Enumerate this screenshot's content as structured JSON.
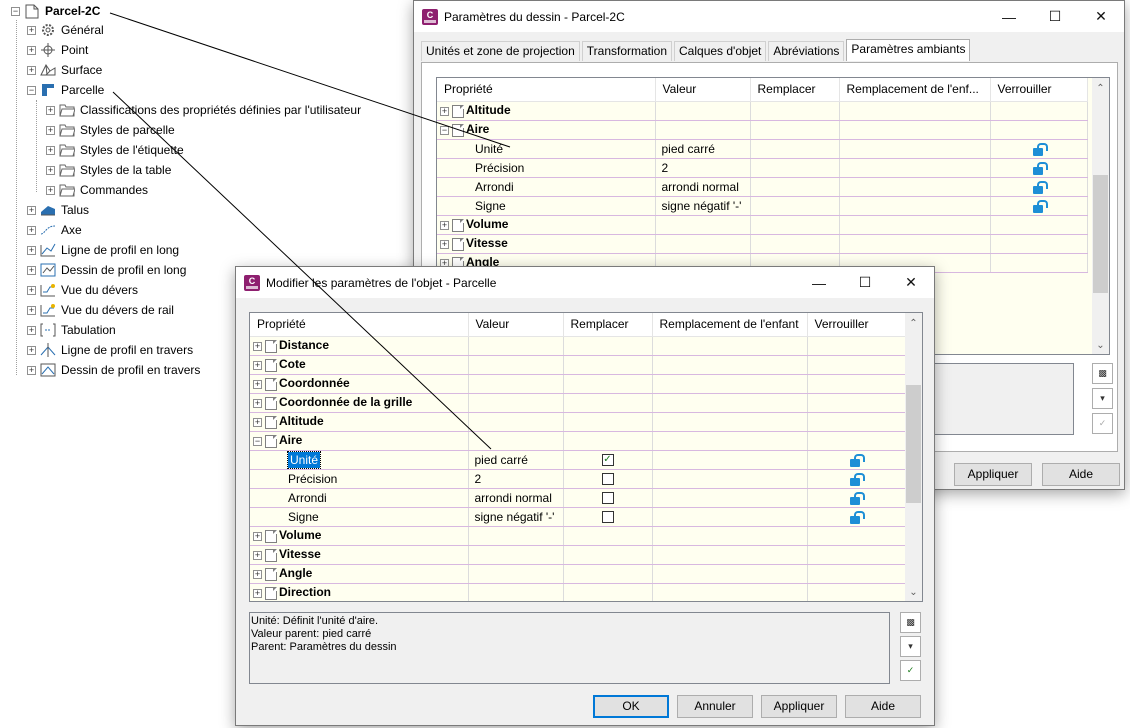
{
  "tree": {
    "root": "Parcel-2C",
    "items": [
      {
        "label": "Général",
        "icon": "gear-icon"
      },
      {
        "label": "Point",
        "icon": "point-icon"
      },
      {
        "label": "Surface",
        "icon": "surface-icon"
      },
      {
        "label": "Parcelle",
        "icon": "parcel-icon"
      },
      {
        "label": "Talus",
        "icon": "grading-icon"
      },
      {
        "label": "Axe",
        "icon": "alignment-icon"
      },
      {
        "label": "Ligne de profil en long",
        "icon": "profile-icon"
      },
      {
        "label": "Dessin de profil en long",
        "icon": "profile-view-icon"
      },
      {
        "label": "Vue du dévers",
        "icon": "superelevation-icon"
      },
      {
        "label": "Vue du dévers de rail",
        "icon": "rail-superelevation-icon"
      },
      {
        "label": "Tabulation",
        "icon": "sample-line-icon"
      },
      {
        "label": "Ligne de profil en travers",
        "icon": "section-icon"
      },
      {
        "label": "Dessin de profil en travers",
        "icon": "section-view-icon"
      }
    ],
    "parcel_children": [
      "Classifications des propriétés définies par l'utilisateur",
      "Styles de parcelle",
      "Styles de l'étiquette",
      "Styles de la table",
      "Commandes"
    ]
  },
  "drawing_settings": {
    "title": "Paramètres du dessin - Parcel-2C",
    "tabs": [
      "Unités et zone de projection",
      "Transformation",
      "Calques d'objet",
      "Abréviations",
      "Paramètres ambiants"
    ],
    "active_tab": "Paramètres ambiants",
    "columns": [
      "Propriété",
      "Valeur",
      "Remplacer",
      "Remplacement de l'enf...",
      "Verrouiller"
    ],
    "rows": [
      {
        "type": "cat",
        "expanded": false,
        "name": "Altitude"
      },
      {
        "type": "cat",
        "expanded": true,
        "name": "Aire"
      },
      {
        "type": "prop",
        "name": "Unité",
        "value": "pied carré"
      },
      {
        "type": "prop",
        "name": "Précision",
        "value": "2"
      },
      {
        "type": "prop",
        "name": "Arrondi",
        "value": "arrondi normal"
      },
      {
        "type": "prop",
        "name": "Signe",
        "value": "signe négatif '-'"
      },
      {
        "type": "cat",
        "expanded": false,
        "name": "Volume"
      },
      {
        "type": "cat",
        "expanded": false,
        "name": "Vitesse"
      },
      {
        "type": "cat",
        "expanded": false,
        "name": "Angle"
      }
    ],
    "buttons": {
      "apply": "Appliquer",
      "help": "Aide"
    }
  },
  "object_settings": {
    "title": "Modifier les paramètres de l'objet - Parcelle",
    "columns": [
      "Propriété",
      "Valeur",
      "Remplacer",
      "Remplacement de l'enfant",
      "Verrouiller"
    ],
    "rows": [
      {
        "type": "cat",
        "name": "Distance"
      },
      {
        "type": "cat",
        "name": "Cote"
      },
      {
        "type": "cat",
        "name": "Coordonnée"
      },
      {
        "type": "cat",
        "name": "Coordonnée de la grille"
      },
      {
        "type": "cat",
        "name": "Altitude"
      },
      {
        "type": "catopen",
        "name": "Aire"
      },
      {
        "type": "prop",
        "name": "Unité",
        "value": "pied carré",
        "override": true,
        "selected": true
      },
      {
        "type": "prop",
        "name": "Précision",
        "value": "2",
        "override": false
      },
      {
        "type": "prop",
        "name": "Arrondi",
        "value": "arrondi normal",
        "override": false
      },
      {
        "type": "prop",
        "name": "Signe",
        "value": "signe négatif '-'",
        "override": false
      },
      {
        "type": "cat",
        "name": "Volume"
      },
      {
        "type": "cat",
        "name": "Vitesse"
      },
      {
        "type": "cat",
        "name": "Angle"
      },
      {
        "type": "cat",
        "name": "Direction"
      }
    ],
    "description": [
      "Unité: Définit l'unité d'aire.",
      "Valeur parent: pied carré",
      "Parent: Paramètres du dessin"
    ],
    "buttons": {
      "ok": "OK",
      "cancel": "Annuler",
      "apply": "Appliquer",
      "help": "Aide"
    }
  },
  "colors": {
    "accent": "#0078d7",
    "grid_bg": "#fffff0",
    "lock": "#1e8fd6",
    "app_icon": "#8e1f6f"
  }
}
